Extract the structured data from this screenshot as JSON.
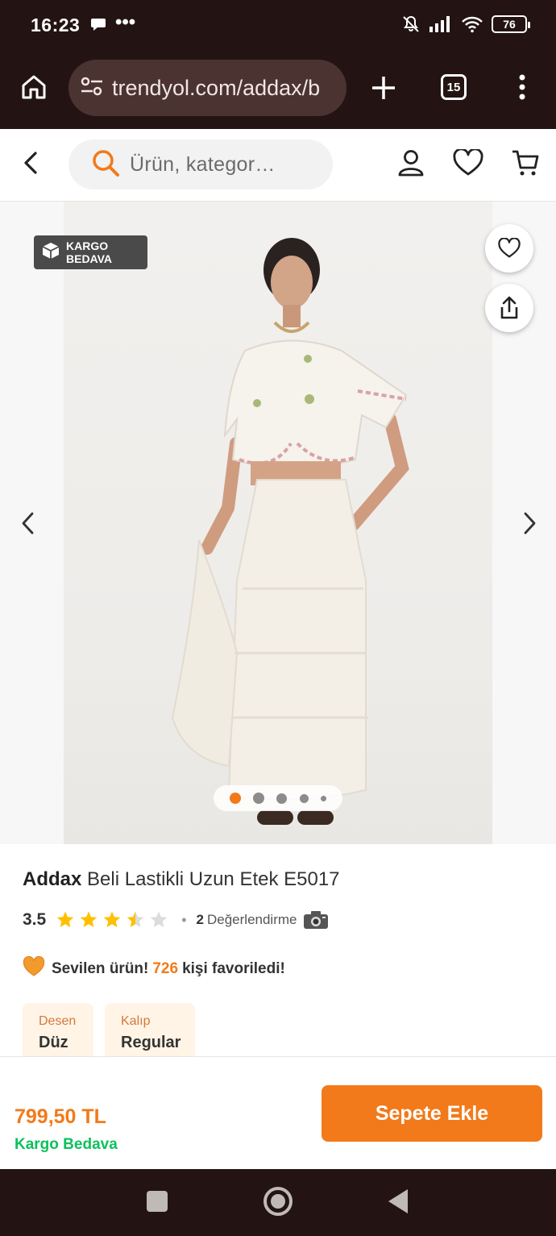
{
  "status_bar": {
    "time": "16:23",
    "dots": "•••",
    "battery": "76"
  },
  "browser": {
    "url": "trendyol.com/addax/b",
    "tab_count": "15"
  },
  "header": {
    "search_placeholder": "Ürün, kategor…"
  },
  "gallery": {
    "badge_line1": "KARGO",
    "badge_line2": "BEDAVA",
    "image_count": 5,
    "active_index": 0
  },
  "product": {
    "brand": "Addax",
    "name": "Beli Lastikli Uzun Etek E5017",
    "rating": "3.5",
    "rating_value": 3.5,
    "separator": "•",
    "review_count": "2",
    "review_label": "Değerlendirme",
    "fav_prefix": "Sevilen ürün!",
    "fav_count": "726",
    "fav_suffix": "kişi favoriledi!"
  },
  "attributes": [
    {
      "key": "Desen",
      "value": "Düz"
    },
    {
      "key": "Kalıp",
      "value": "Regular"
    }
  ],
  "purchase": {
    "price": "799,50 TL",
    "shipping": "Kargo Bedava",
    "button": "Sepete Ekle"
  },
  "colors": {
    "brand_orange": "#f27a1a",
    "green": "#0bc15c",
    "dark": "#231413",
    "star": "#ffc000"
  },
  "icons": [
    "home-icon",
    "tune-icon",
    "plus-icon",
    "tabs-icon",
    "menu-icon",
    "back-icon",
    "search-icon",
    "user-icon",
    "heart-icon",
    "cart-icon",
    "box-icon",
    "share-icon",
    "chevron-left-icon",
    "chevron-right-icon",
    "star-icon",
    "camera-icon"
  ]
}
